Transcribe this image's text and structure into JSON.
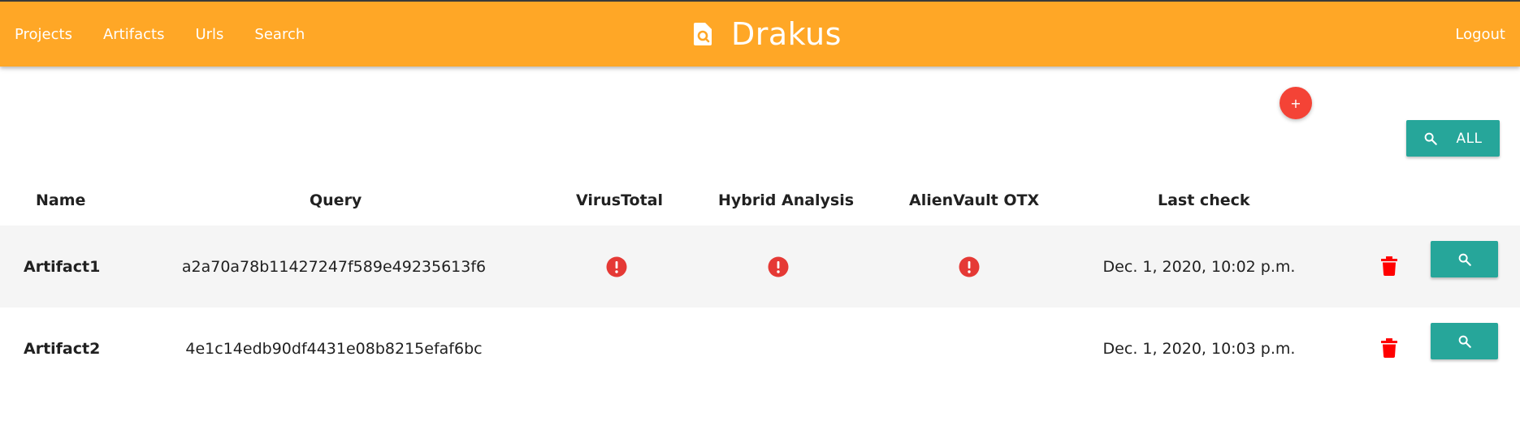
{
  "nav": {
    "links": [
      {
        "label": "Projects"
      },
      {
        "label": "Artifacts"
      },
      {
        "label": "Urls"
      },
      {
        "label": "Search"
      }
    ],
    "brand": "Drakus",
    "logout": "Logout",
    "color": "#ffa726"
  },
  "actions": {
    "add_label": "+",
    "search_all_label": "ALL"
  },
  "table": {
    "headers": {
      "name": "Name",
      "query": "Query",
      "virustotal": "VirusTotal",
      "hybrid": "Hybrid Analysis",
      "otx": "AlienVault OTX",
      "last_check": "Last check"
    },
    "rows": [
      {
        "name": "Artifact1",
        "query": "a2a70a78b11427247f589e49235613f6",
        "virustotal": "error-icon",
        "hybrid": "error-icon",
        "otx": "error-icon",
        "last_check": "Dec. 1, 2020, 10:02 p.m."
      },
      {
        "name": "Artifact2",
        "query": "4e1c14edb90df4431e08b8215efaf6bc",
        "virustotal": "",
        "hybrid": "",
        "otx": "",
        "last_check": "Dec. 1, 2020, 10:03 p.m."
      }
    ]
  },
  "colors": {
    "accent": "#26a69a",
    "danger": "#f44336",
    "error": "#e53935"
  }
}
